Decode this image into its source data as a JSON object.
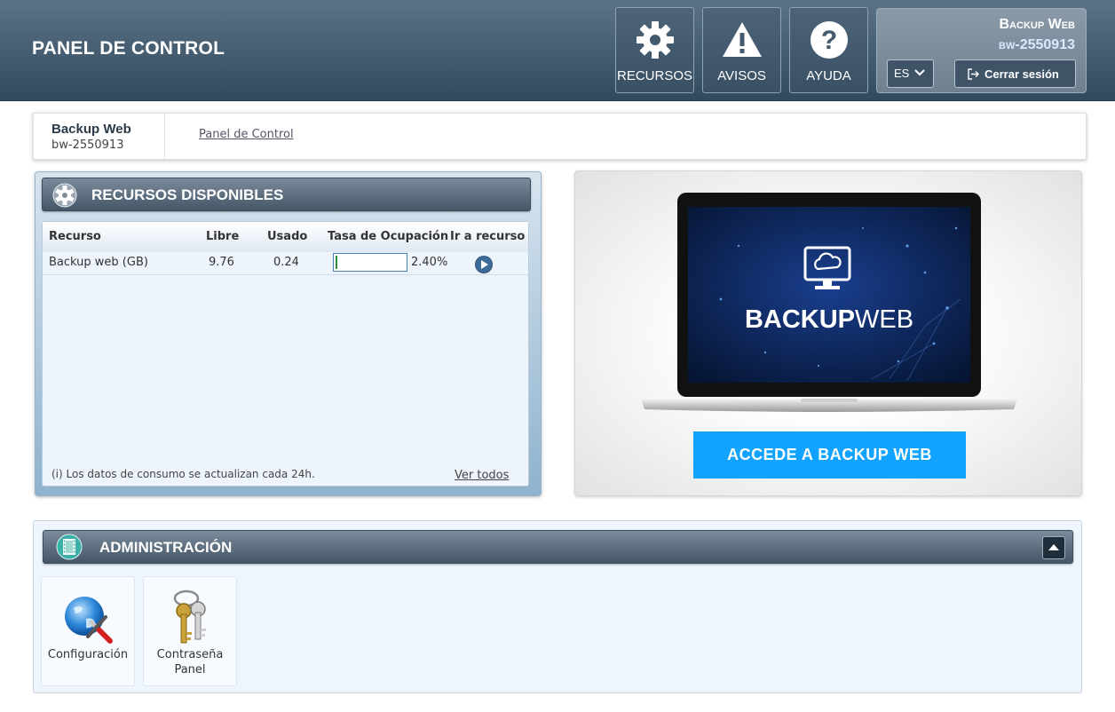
{
  "header": {
    "title": "PANEL DE CONTROL",
    "buttons": [
      {
        "label": "RECURSOS",
        "icon": "gear-icon"
      },
      {
        "label": "AVISOS",
        "icon": "warning-icon"
      },
      {
        "label": "AYUDA",
        "icon": "help-icon"
      }
    ],
    "user": {
      "service": "Backup Web",
      "account": "bw-2550913",
      "language": "ES",
      "logout_label": "Cerrar sesión"
    }
  },
  "breadcrumb": {
    "service": "Backup Web",
    "account": "bw-2550913",
    "link": "Panel de Control"
  },
  "resources": {
    "title": "RECURSOS DISPONIBLES",
    "columns": [
      "Recurso",
      "Libre",
      "Usado",
      "Tasa de Ocupación",
      "Ir a recurso"
    ],
    "rows": [
      {
        "name": "Backup web (GB)",
        "free": "9.76",
        "used": "0.24",
        "occupancy_label": "2.40%",
        "occupancy": 0.024
      }
    ],
    "note": "(i) Los datos de consumo se actualizan cada 24h.",
    "view_all": "Ver todos"
  },
  "promo": {
    "logo_bold": "BACKUP",
    "logo_light": "WEB",
    "button_label": "ACCEDE A BACKUP WEB",
    "accent": "#11a3ff"
  },
  "admin": {
    "title": "ADMINISTRACIÓN",
    "tiles": [
      {
        "label": "Configuración",
        "icon": "globe-tools-icon"
      },
      {
        "label": "Contraseña Panel",
        "icon": "keys-icon"
      }
    ]
  }
}
